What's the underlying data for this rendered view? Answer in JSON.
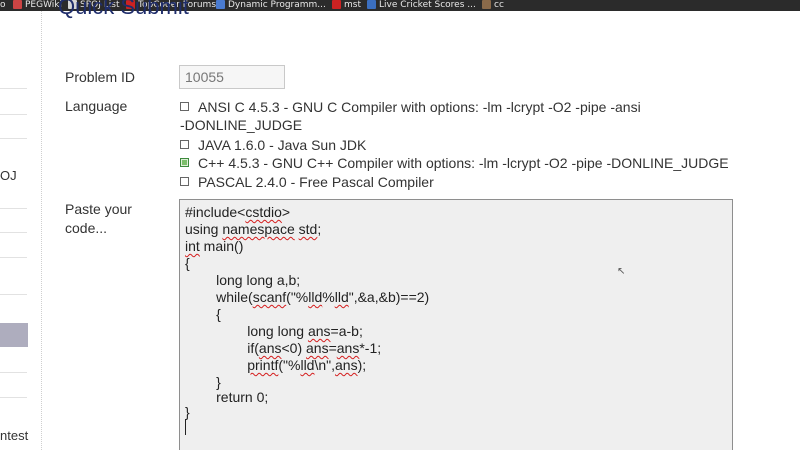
{
  "bookmarks": [
    {
      "label": "o",
      "icon": "bookmark-favicon",
      "color": "#2b2b2b"
    },
    {
      "label": "PEGWiki",
      "icon": "pegwiki-favicon",
      "color": "#c44"
    },
    {
      "label": "SPOJ List",
      "icon": "spoj-favicon",
      "color": "#d6d6d6"
    },
    {
      "label": "TopCoder Forums",
      "icon": "topcoder-favicon",
      "color": "#c22"
    },
    {
      "label": "Dynamic Programm...",
      "icon": "dp-favicon",
      "color": "#4a7bd0"
    },
    {
      "label": "mst",
      "icon": "mst-favicon",
      "color": "#c22"
    },
    {
      "label": "Live Cricket Scores ...",
      "icon": "cricinfo-favicon",
      "color": "#3b6fc0"
    },
    {
      "label": "cc",
      "icon": "codechef-favicon",
      "color": "#8a6a4a"
    }
  ],
  "page": {
    "title": "Quick Submit"
  },
  "sidebar": {
    "text1": "OJ",
    "text2": "ntest"
  },
  "form": {
    "problem_id_label": "Problem ID",
    "problem_id_value": "10055",
    "language_label": "Language",
    "paste_label_line1": "Paste your",
    "paste_label_line2": "code..."
  },
  "languages": [
    {
      "label": "ANSI C 4.5.3 - GNU C Compiler with options: -lm -lcrypt -O2 -pipe -ansi",
      "cont": "-DONLINE_JUDGE",
      "checked": false
    },
    {
      "label": "JAVA 1.6.0 - Java Sun JDK",
      "checked": false
    },
    {
      "label": "C++ 4.5.3 - GNU C++ Compiler with options: -lm -lcrypt -O2 -pipe -DONLINE_JUDGE",
      "checked": true
    },
    {
      "label": "PASCAL 2.4.0 - Free Pascal Compiler",
      "checked": false
    }
  ],
  "code": {
    "l1a": "#include<",
    "l1b": "cstdio",
    "l1c": ">",
    "l2a": "using ",
    "l2b": "namespace",
    "l2c": " ",
    "l2d": "std",
    "l2e": ";",
    "l3a": "int",
    "l3b": " main()",
    "l4": "{",
    "l5": "        long long a,b;",
    "l6a": "        while(",
    "l6b": "scanf",
    "l6c": "(\"%",
    "l6d": "lld",
    "l6e": "%",
    "l6f": "lld",
    "l6g": "\",&a,&b)==2)",
    "l7": "        {",
    "l8a": "                long long ",
    "l8b": "ans",
    "l8c": "=a-b;",
    "l9a": "                if(",
    "l9b": "ans",
    "l9c": "<0) ",
    "l9d": "ans",
    "l9e": "=",
    "l9f": "ans",
    "l9g": "*-1;",
    "l10a": "                ",
    "l10b": "printf",
    "l10c": "(\"%",
    "l10d": "lld",
    "l10e": "\\n\",",
    "l10f": "ans",
    "l10g": ");",
    "l11": "        }",
    "l12": "        return 0;",
    "l13": "}"
  }
}
